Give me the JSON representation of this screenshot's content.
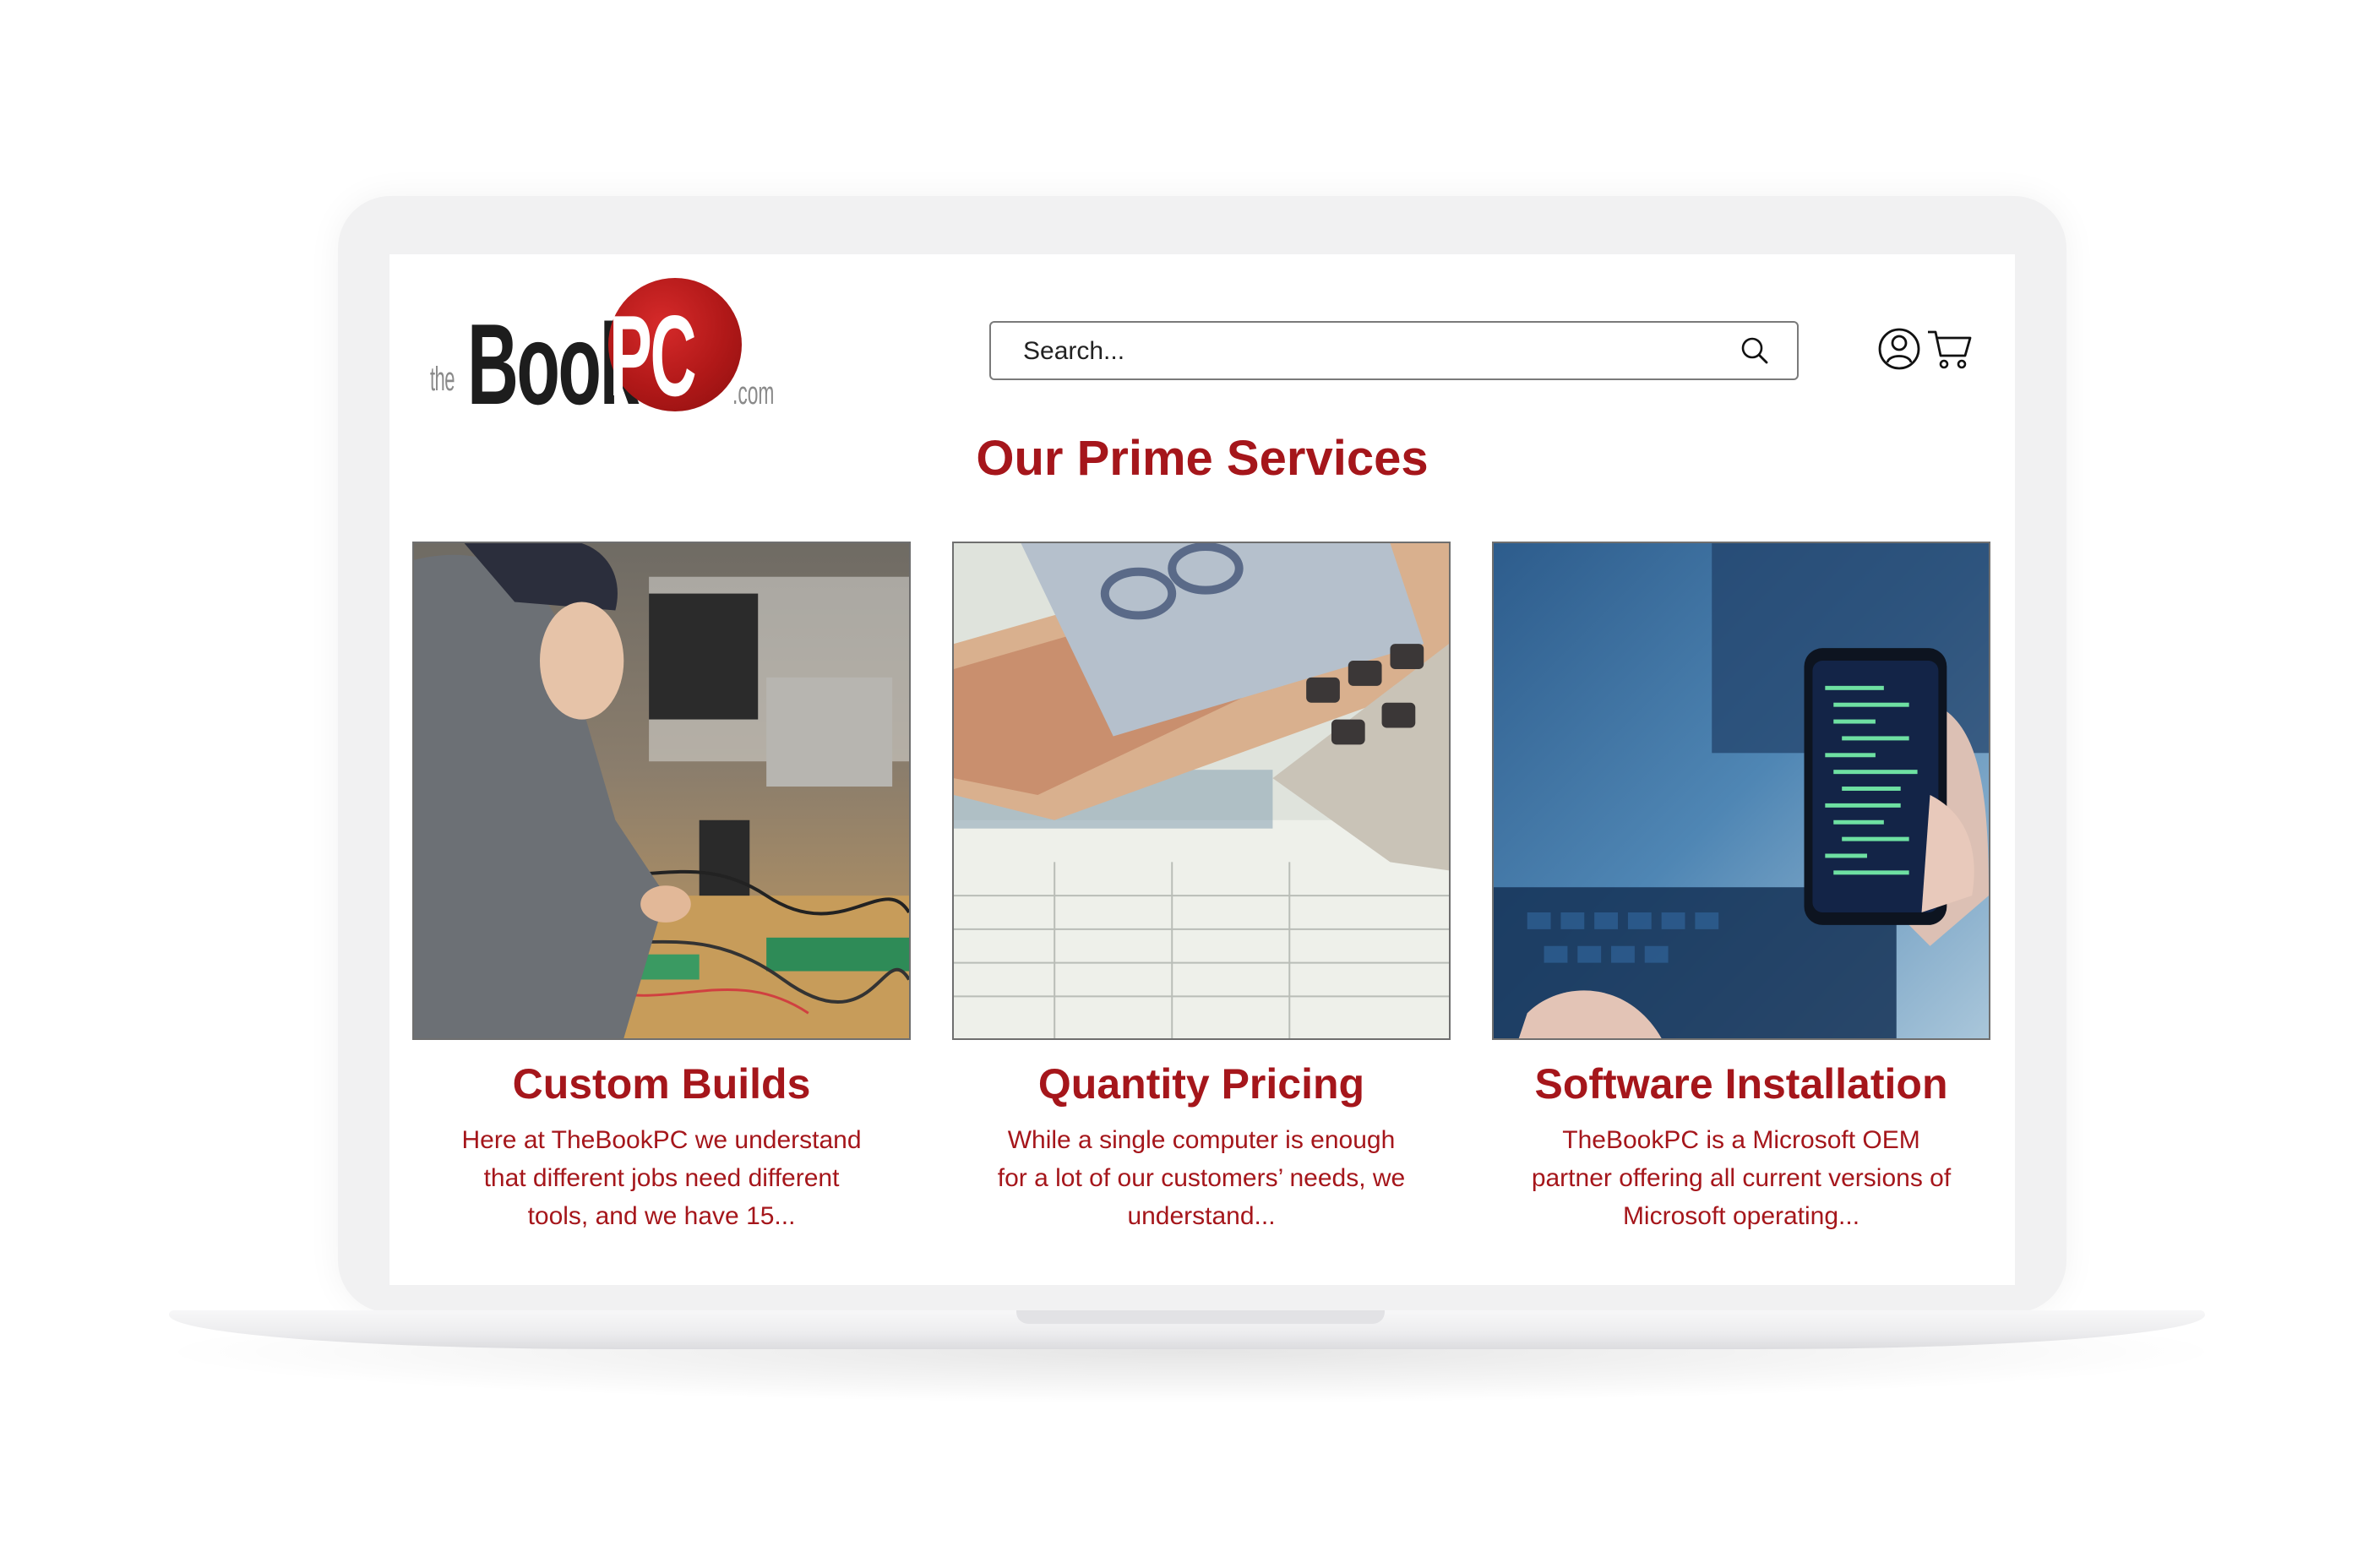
{
  "header": {
    "logo": {
      "the": "the",
      "book": "Book",
      "pc": "PC",
      "dotcom": ".com"
    },
    "search": {
      "placeholder": "Search..."
    },
    "icons": {
      "search": "search-icon",
      "account": "user-icon",
      "cart": "cart-icon"
    }
  },
  "main": {
    "title": "Our Prime Services",
    "cards": [
      {
        "title": "Custom Builds",
        "text": "Here at TheBookPC we understand that different jobs need different tools, and we have 15..."
      },
      {
        "title": "Quantity Pricing",
        "text": "While a single computer is enough for a lot of our customers’ needs, we understand..."
      },
      {
        "title": "Software Installation",
        "text": "TheBookPC is a Microsoft OEM partner offering all current versions of Microsoft operating..."
      }
    ]
  },
  "colors": {
    "brand_red": "#a5161b",
    "logo_red": "#b01818"
  }
}
